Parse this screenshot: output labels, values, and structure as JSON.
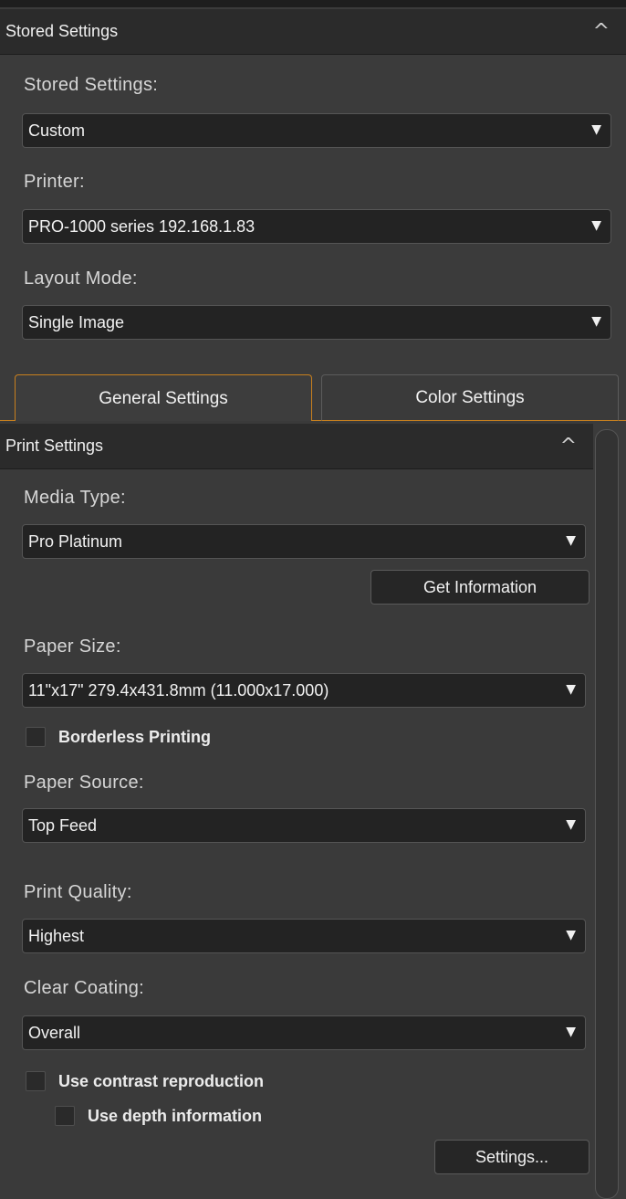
{
  "stored_section": {
    "header": "Stored Settings",
    "caret": "^",
    "stored_settings_label": "Stored Settings:",
    "stored_settings_value": "Custom",
    "printer_label": "Printer:",
    "printer_value": "PRO-1000 series 192.168.1.83",
    "layout_mode_label": "Layout Mode:",
    "layout_mode_value": "Single Image"
  },
  "tabs": [
    {
      "label": "General Settings",
      "active": true
    },
    {
      "label": "Color Settings",
      "active": false
    }
  ],
  "print_section": {
    "header": "Print Settings",
    "caret": "^",
    "media_type_label": "Media Type:",
    "media_type_value": "Pro Platinum",
    "get_information_button": "Get Information",
    "paper_size_label": "Paper Size:",
    "paper_size_value": "11\"x17\" 279.4x431.8mm (11.000x17.000)",
    "borderless_label": "Borderless Printing",
    "borderless_checked": false,
    "paper_source_label": "Paper Source:",
    "paper_source_value": "Top Feed",
    "print_quality_label": "Print Quality:",
    "print_quality_value": "Highest",
    "clear_coating_label": "Clear Coating:",
    "clear_coating_value": "Overall",
    "contrast_label": "Use contrast reproduction",
    "contrast_checked": false,
    "depth_label": "Use depth information",
    "depth_checked": false,
    "settings_button": "Settings..."
  },
  "colors": {
    "accent": "#c8801e",
    "panel_bg": "#3a3a3a",
    "header_bg": "#2b2b2b",
    "field_bg": "#232323"
  },
  "icons": {
    "collapse": "chevron-up-icon",
    "dropdown": "triangle-down-icon",
    "scrollbar": "vertical-scrollbar"
  }
}
